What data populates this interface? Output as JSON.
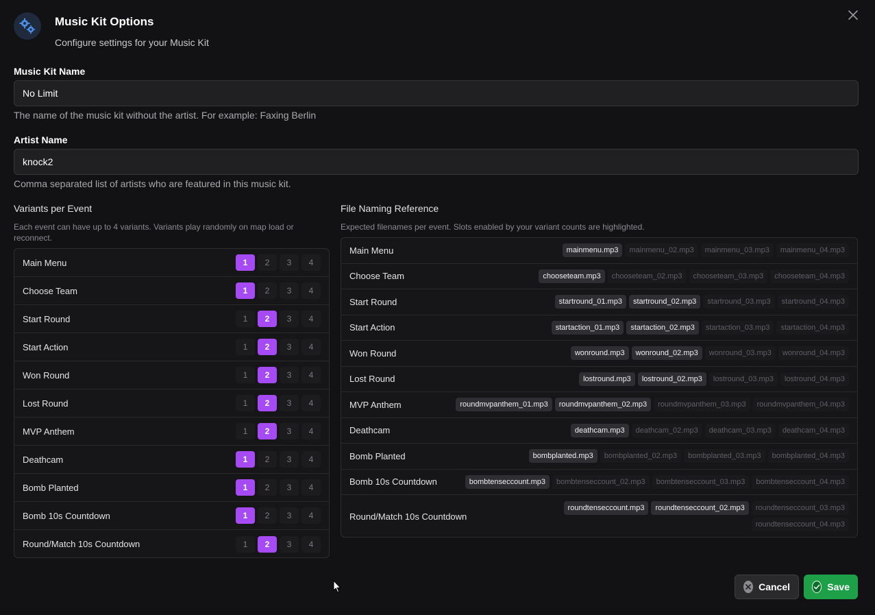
{
  "header": {
    "title": "Music Kit Options",
    "subtitle": "Configure settings for your Music Kit",
    "icon": "gears-icon"
  },
  "kit_name": {
    "label": "Music Kit Name",
    "value": "No Limit",
    "help": "The name of the music kit without the artist. For example: Faxing Berlin"
  },
  "artist_name": {
    "label": "Artist Name",
    "value": "knock2",
    "help": "Comma separated list of artists who are featured in this music kit."
  },
  "variants": {
    "title": "Variants per Event",
    "description": "Each event can have up to 4 variants. Variants play randomly on map load or reconnect.",
    "options": [
      "1",
      "2",
      "3",
      "4"
    ],
    "rows": [
      {
        "label": "Main Menu",
        "selected": 1
      },
      {
        "label": "Choose Team",
        "selected": 1
      },
      {
        "label": "Start Round",
        "selected": 2
      },
      {
        "label": "Start Action",
        "selected": 2
      },
      {
        "label": "Won Round",
        "selected": 2
      },
      {
        "label": "Lost Round",
        "selected": 2
      },
      {
        "label": "MVP Anthem",
        "selected": 2
      },
      {
        "label": "Deathcam",
        "selected": 1
      },
      {
        "label": "Bomb Planted",
        "selected": 1
      },
      {
        "label": "Bomb 10s Countdown",
        "selected": 1
      },
      {
        "label": "Round/Match 10s Countdown",
        "selected": 2
      }
    ]
  },
  "file_naming": {
    "title": "File Naming Reference",
    "description": "Expected filenames per event. Slots enabled by your variant counts are highlighted.",
    "rows": [
      {
        "label": "Main Menu",
        "files": [
          "mainmenu.mp3",
          "mainmenu_02.mp3",
          "mainmenu_03.mp3",
          "mainmenu_04.mp3"
        ],
        "enabled": 1
      },
      {
        "label": "Choose Team",
        "files": [
          "chooseteam.mp3",
          "chooseteam_02.mp3",
          "chooseteam_03.mp3",
          "chooseteam_04.mp3"
        ],
        "enabled": 1
      },
      {
        "label": "Start Round",
        "files": [
          "startround_01.mp3",
          "startround_02.mp3",
          "startround_03.mp3",
          "startround_04.mp3"
        ],
        "enabled": 2
      },
      {
        "label": "Start Action",
        "files": [
          "startaction_01.mp3",
          "startaction_02.mp3",
          "startaction_03.mp3",
          "startaction_04.mp3"
        ],
        "enabled": 2
      },
      {
        "label": "Won Round",
        "files": [
          "wonround.mp3",
          "wonround_02.mp3",
          "wonround_03.mp3",
          "wonround_04.mp3"
        ],
        "enabled": 2
      },
      {
        "label": "Lost Round",
        "files": [
          "lostround.mp3",
          "lostround_02.mp3",
          "lostround_03.mp3",
          "lostround_04.mp3"
        ],
        "enabled": 2
      },
      {
        "label": "MVP Anthem",
        "files": [
          "roundmvpanthem_01.mp3",
          "roundmvpanthem_02.mp3",
          "roundmvpanthem_03.mp3",
          "roundmvpanthem_04.mp3"
        ],
        "enabled": 2
      },
      {
        "label": "Deathcam",
        "files": [
          "deathcam.mp3",
          "deathcam_02.mp3",
          "deathcam_03.mp3",
          "deathcam_04.mp3"
        ],
        "enabled": 1
      },
      {
        "label": "Bomb Planted",
        "files": [
          "bombplanted.mp3",
          "bombplanted_02.mp3",
          "bombplanted_03.mp3",
          "bombplanted_04.mp3"
        ],
        "enabled": 1
      },
      {
        "label": "Bomb 10s Countdown",
        "files": [
          "bombtenseccount.mp3",
          "bombtenseccount_02.mp3",
          "bombtenseccount_03.mp3",
          "bombtenseccount_04.mp3"
        ],
        "enabled": 1
      },
      {
        "label": "Round/Match 10s Countdown",
        "files": [
          "roundtenseccount.mp3",
          "roundtenseccount_02.mp3",
          "roundtenseccount_03.mp3",
          "roundtenseccount_04.mp3"
        ],
        "enabled": 2
      }
    ]
  },
  "footer": {
    "cancel_label": "Cancel",
    "save_label": "Save"
  },
  "colors": {
    "accent": "#a64bf4",
    "save": "#1ea048"
  }
}
